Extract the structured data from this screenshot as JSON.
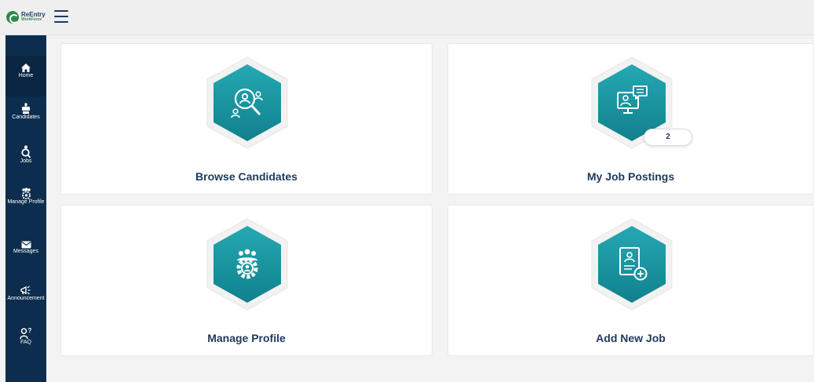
{
  "app": {
    "logo_line1": "ReEntry",
    "logo_line2": "WorkForce"
  },
  "sidebar": {
    "items": [
      {
        "label": "Home",
        "icon": "home-icon"
      },
      {
        "label": "Candidates",
        "icon": "candidates-icon"
      },
      {
        "label": "Jobs",
        "icon": "jobs-icon"
      },
      {
        "label": "Manage Profile",
        "icon": "manage-profile-icon"
      },
      {
        "label": "Messages",
        "icon": "envelope-icon"
      },
      {
        "label": "Announcement",
        "icon": "megaphone-icon"
      },
      {
        "label": "FAQ",
        "icon": "faq-icon"
      }
    ]
  },
  "cards": [
    {
      "title": "Browse Candidates",
      "icon": "search-people-icon"
    },
    {
      "title": "My Job Postings",
      "icon": "job-posting-monitor-icon",
      "badge": "2"
    },
    {
      "title": "Manage Profile",
      "icon": "team-gear-icon"
    },
    {
      "title": "Add New Job",
      "icon": "add-resume-icon"
    }
  ],
  "colors": {
    "sidebar": "#0c2d4e",
    "accent": "#1a9aa6",
    "title": "#1e3a5c"
  }
}
